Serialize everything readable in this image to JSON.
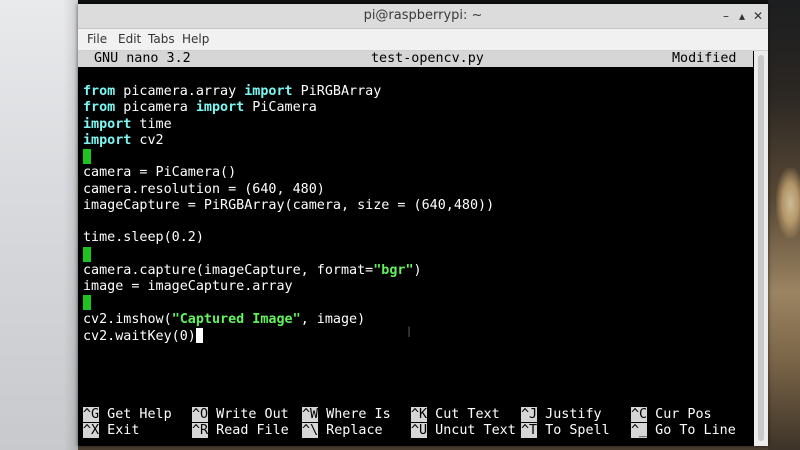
{
  "window": {
    "title": "pi@raspberrypi: ~",
    "controls": [
      "–",
      "▴",
      "✕"
    ]
  },
  "menu": [
    "File",
    "Edit",
    "Tabs",
    "Help"
  ],
  "nano": {
    "version": "GNU nano 3.2",
    "filename": "test-opencv.py",
    "status": "Modified"
  },
  "code": [
    {
      "segments": [
        {
          "t": "from",
          "c": "kw"
        },
        {
          "t": " picamera.array "
        },
        {
          "t": "import",
          "c": "kw"
        },
        {
          "t": " PiRGBArray"
        }
      ]
    },
    {
      "segments": [
        {
          "t": "from",
          "c": "kw"
        },
        {
          "t": " picamera "
        },
        {
          "t": "import",
          "c": "kw"
        },
        {
          "t": " PiCamera"
        }
      ]
    },
    {
      "segments": [
        {
          "t": "import",
          "c": "kw"
        },
        {
          "t": " time"
        }
      ]
    },
    {
      "segments": [
        {
          "t": "import",
          "c": "kw"
        },
        {
          "t": " cv2"
        }
      ]
    },
    {
      "segments": [
        {
          "cursor": "green"
        }
      ]
    },
    {
      "segments": [
        {
          "t": "camera = PiCamera()"
        }
      ]
    },
    {
      "segments": [
        {
          "t": "camera.resolution = (640, 480)"
        }
      ]
    },
    {
      "segments": [
        {
          "t": "imageCapture = PiRGBArray(camera, size = (640,480))"
        }
      ]
    },
    {
      "segments": []
    },
    {
      "segments": [
        {
          "t": "time.sleep(0.2)"
        }
      ]
    },
    {
      "segments": [
        {
          "cursor": "green"
        }
      ]
    },
    {
      "segments": [
        {
          "t": "camera.capture(imageCapture, format="
        },
        {
          "t": "\"bgr\"",
          "c": "str"
        },
        {
          "t": ")"
        }
      ]
    },
    {
      "segments": [
        {
          "t": "image = imageCapture.array"
        }
      ]
    },
    {
      "segments": [
        {
          "cursor": "green"
        }
      ]
    },
    {
      "segments": [
        {
          "t": "cv2.imshow("
        },
        {
          "t": "\"Captured Image\"",
          "c": "str"
        },
        {
          "t": ", image)"
        }
      ]
    },
    {
      "segments": [
        {
          "t": "cv2.waitKey(0)"
        },
        {
          "cursor": "white"
        }
      ]
    }
  ],
  "shortcuts": [
    [
      {
        "key": "^G",
        "desc": "Get Help"
      },
      {
        "key": "^O",
        "desc": "Write Out"
      },
      {
        "key": "^W",
        "desc": "Where Is"
      },
      {
        "key": "^K",
        "desc": "Cut Text"
      },
      {
        "key": "^J",
        "desc": "Justify"
      },
      {
        "key": "^C",
        "desc": "Cur Pos"
      }
    ],
    [
      {
        "key": "^X",
        "desc": "Exit"
      },
      {
        "key": "^R",
        "desc": "Read File"
      },
      {
        "key": "^\\",
        "desc": "Replace"
      },
      {
        "key": "^U",
        "desc": "Uncut Text"
      },
      {
        "key": "^T",
        "desc": "To Spell"
      },
      {
        "key": "^_",
        "desc": "Go To Line"
      }
    ]
  ]
}
